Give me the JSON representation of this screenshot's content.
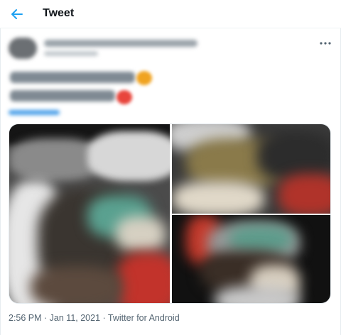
{
  "header": {
    "title": "Tweet",
    "accent_color": "#1da1f2"
  },
  "tweet": {
    "author_name": "",
    "author_handle": "",
    "more_icon": "more-dots-icon",
    "timestamp_time": "2:56 PM",
    "separator": " · ",
    "timestamp_date": "Jan 11, 2021",
    "source": "Twitter for Android",
    "media_count": 3
  }
}
